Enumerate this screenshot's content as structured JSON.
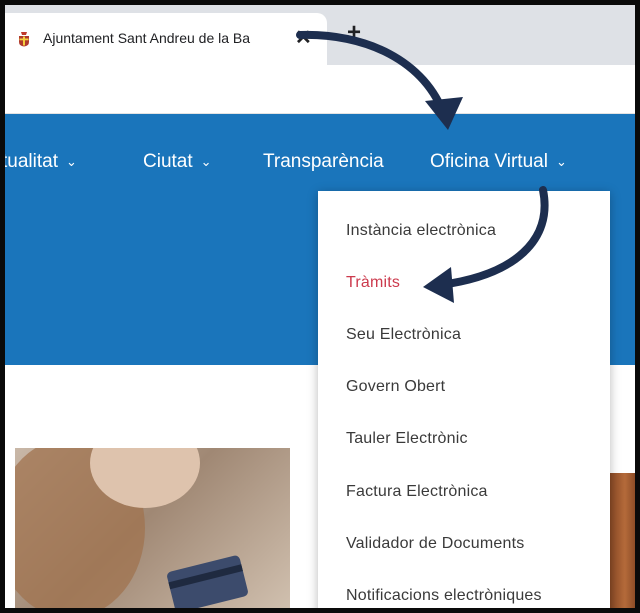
{
  "browser": {
    "tab_title": "Ajuntament Sant Andreu de la Ba",
    "close_symbol": "✕",
    "new_tab_symbol": "+"
  },
  "nav": {
    "items": [
      {
        "label": "tualitat"
      },
      {
        "label": "Ciutat"
      },
      {
        "label": "Transparència"
      },
      {
        "label": "Oficina Virtual"
      }
    ]
  },
  "dropdown": {
    "items": [
      {
        "label": "Instància electrònica"
      },
      {
        "label": "Tràmits",
        "active": true
      },
      {
        "label": "Seu Electrònica"
      },
      {
        "label": "Govern Obert"
      },
      {
        "label": "Tauler Electrònic"
      },
      {
        "label": "Factura Electrònica"
      },
      {
        "label": "Validador de Documents"
      },
      {
        "label": "Notificacions electròniques"
      }
    ]
  },
  "colors": {
    "nav_bg": "#1a75bb",
    "active_item": "#cc3a4d",
    "arrow": "#1d2e4f",
    "frame": "#0a0a0a"
  },
  "icons": {
    "favicon": "municipal-crest-icon",
    "dropdown_indicator": "chevron-down-icon"
  }
}
